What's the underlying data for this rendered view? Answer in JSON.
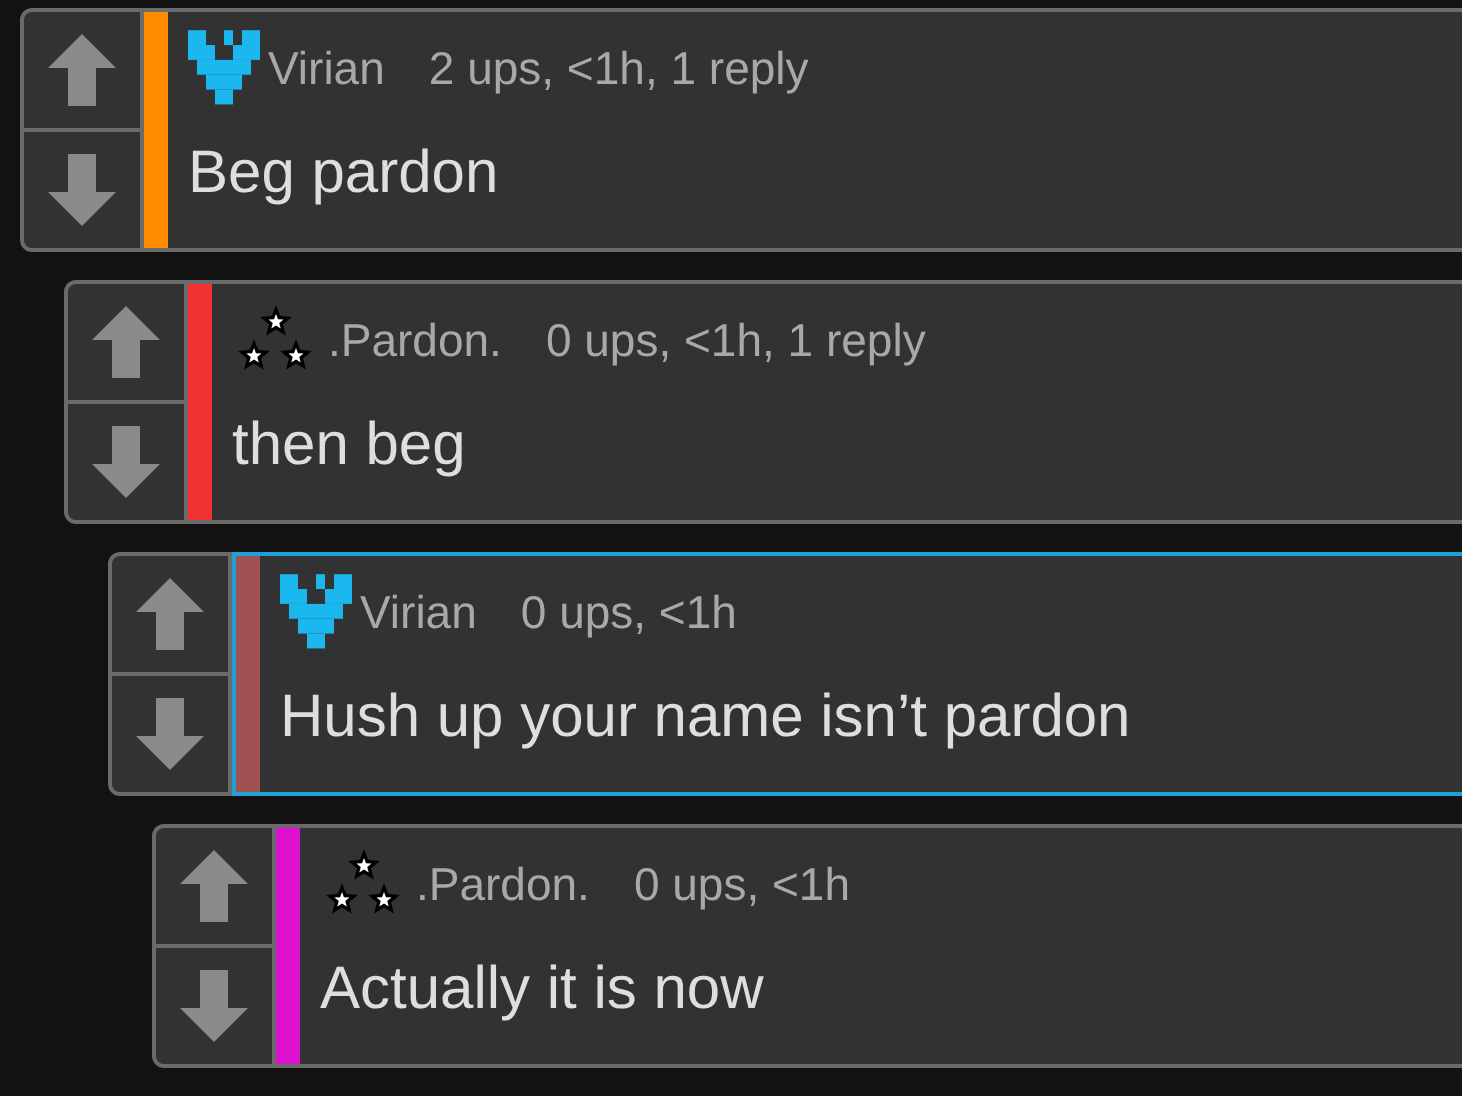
{
  "comments": [
    {
      "avatar": {
        "kind": "pixel-v"
      },
      "color": "#ff8c00",
      "author": "Virian",
      "meta": "2 ups, <1h, 1 reply",
      "text": "Beg pardon",
      "highlighted": false,
      "children": [
        {
          "avatar": {
            "kind": "stars"
          },
          "color": "#f03232",
          "author": ".Pardon.",
          "meta": "0 ups, <1h, 1 reply",
          "text": "then beg",
          "highlighted": false,
          "children": [
            {
              "avatar": {
                "kind": "pixel-v"
              },
              "color": "#a05252",
              "author": "Virian",
              "meta": "0 ups, <1h",
              "text": "Hush up your name isn’t pardon",
              "highlighted": true,
              "children": [
                {
                  "avatar": {
                    "kind": "stars"
                  },
                  "color": "#e010d0",
                  "author": ".Pardon.",
                  "meta": "0 ups, <1h",
                  "text": "Actually it is now",
                  "highlighted": false
                }
              ]
            }
          ]
        }
      ]
    }
  ]
}
